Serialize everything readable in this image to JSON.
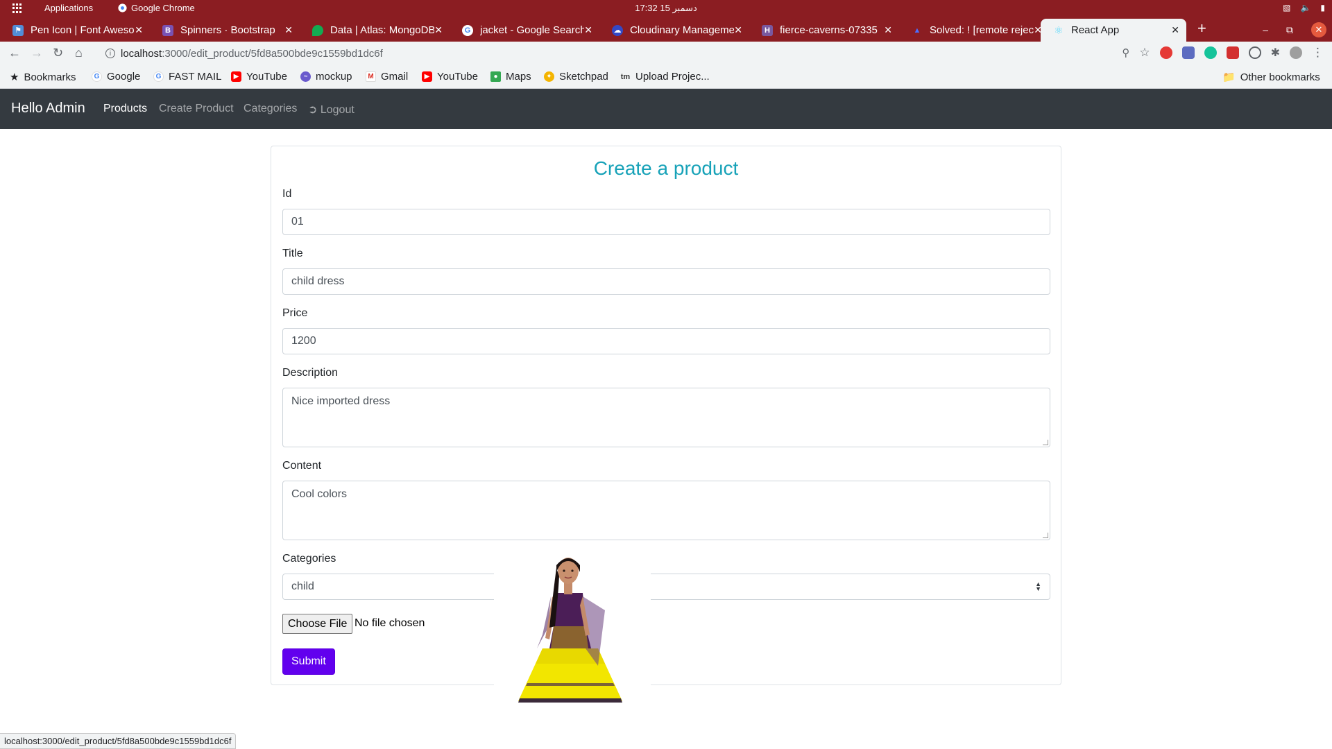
{
  "os": {
    "apps_label": "Applications",
    "chrome_label": "Google Chrome",
    "clock": "دسمبر 15 17:32"
  },
  "tabs": [
    {
      "title": "Pen Icon | Font Awesome",
      "favicon": "flag-icon",
      "color": "#528dd7"
    },
    {
      "title": "Spinners · Bootstrap",
      "favicon": "bootstrap-icon",
      "color": "#7952b3"
    },
    {
      "title": "Data | Atlas: MongoDB",
      "favicon": "leaf-icon",
      "color": "#13aa52"
    },
    {
      "title": "jacket - Google Search",
      "favicon": "google-icon",
      "color": "#4285f4"
    },
    {
      "title": "Cloudinary Management",
      "favicon": "cloud-icon",
      "color": "#3448c5"
    },
    {
      "title": "fierce-caverns-07335",
      "favicon": "heroku-icon",
      "color": "#79589f"
    },
    {
      "title": "Solved: ! [remote rejected]",
      "favicon": "atlassian-icon",
      "color": "#0052cc"
    },
    {
      "title": "React App",
      "favicon": "react-icon",
      "color": "#61dafb"
    }
  ],
  "address": {
    "host": "localhost",
    "path": ":3000/edit_product/5fd8a500bde9c1559bd1dc6f"
  },
  "bookmarks": {
    "items": [
      {
        "label": "Bookmarks",
        "icon": "star-icon"
      },
      {
        "label": "Google",
        "icon": "google-icon"
      },
      {
        "label": "FAST MAIL",
        "icon": "google-icon"
      },
      {
        "label": "YouTube",
        "icon": "youtube-icon"
      },
      {
        "label": "mockup",
        "icon": "mockup-icon"
      },
      {
        "label": "Gmail",
        "icon": "gmail-icon"
      },
      {
        "label": "YouTube",
        "icon": "youtube-icon"
      },
      {
        "label": "Maps",
        "icon": "maps-icon"
      },
      {
        "label": "Sketchpad",
        "icon": "sketchpad-icon"
      },
      {
        "label": "Upload Projec...",
        "icon": "tm-icon"
      }
    ],
    "other": "Other bookmarks"
  },
  "navbar": {
    "brand": "Hello Admin",
    "links": [
      "Products",
      "Create Product",
      "Categories",
      "Logout"
    ]
  },
  "form": {
    "heading": "Create a product",
    "id_label": "Id",
    "id_value": "01",
    "title_label": "Title",
    "title_value": "child dress",
    "price_label": "Price",
    "price_value": "1200",
    "description_label": "Description",
    "description_value": "Nice imported dress",
    "content_label": "Content",
    "content_value": "Cool colors",
    "categories_label": "Categories",
    "category_value": "child",
    "choose_file_label": "Choose File",
    "no_file_text": "No file chosen",
    "submit_label": "Submit"
  },
  "status_url": "localhost:3000/edit_product/5fd8a500bde9c1559bd1dc6f",
  "colors": {
    "os_bar": "#8b1d22",
    "navbar": "#343a40",
    "heading": "#17a2b8",
    "submit": "#6200ee"
  }
}
